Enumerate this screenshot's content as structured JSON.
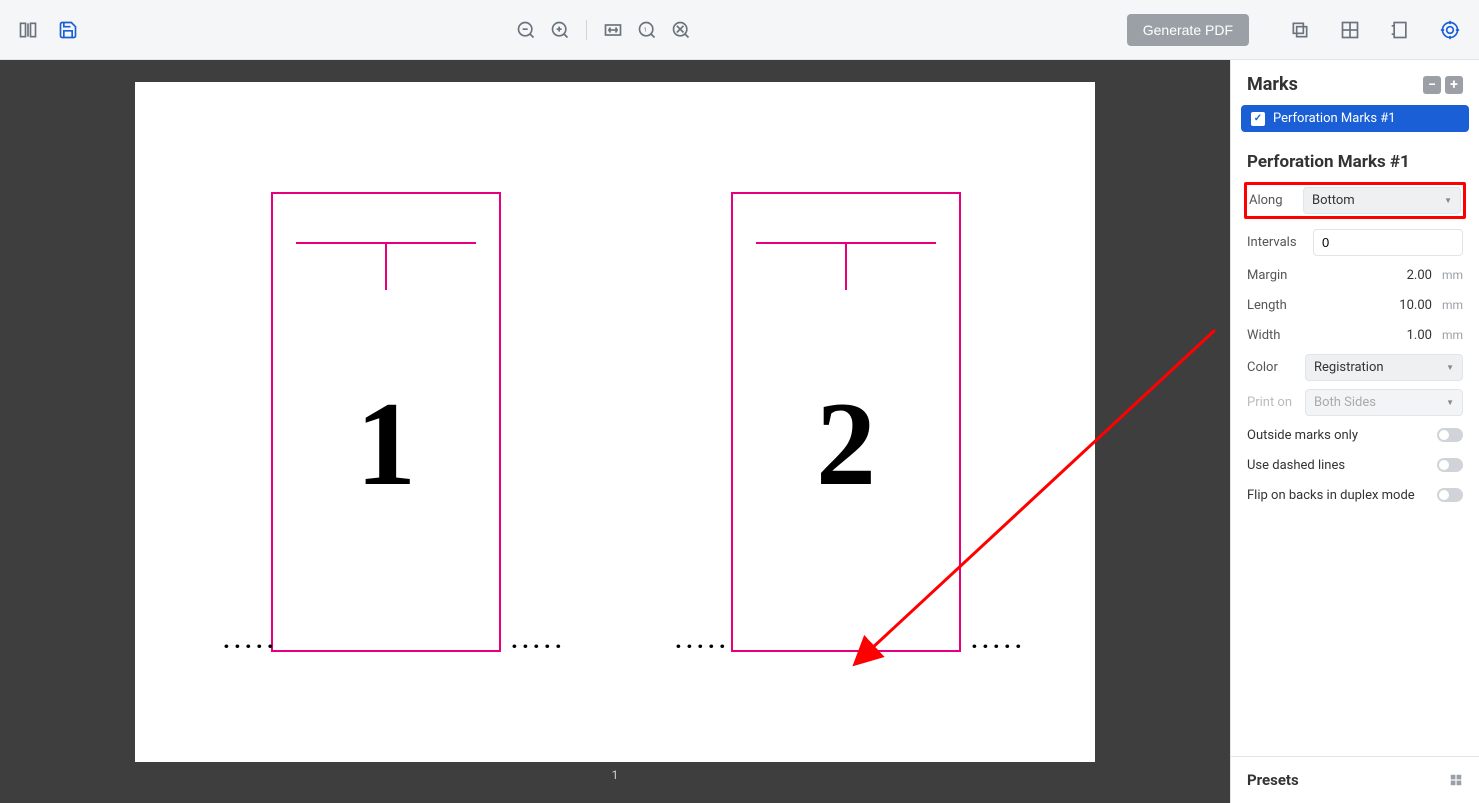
{
  "toolbar": {
    "generate_label": "Generate PDF"
  },
  "canvas": {
    "page_number": "1",
    "card1_num": "1",
    "card2_num": "2",
    "perf_glyph": "....."
  },
  "marks_panel": {
    "title": "Marks",
    "items": [
      {
        "label": "Perforation Marks #1"
      }
    ]
  },
  "props": {
    "title": "Perforation Marks #1",
    "along_label": "Along",
    "along_value": "Bottom",
    "intervals_label": "Intervals",
    "intervals_value": "0",
    "margin_label": "Margin",
    "margin_value": "2.00",
    "length_label": "Length",
    "length_value": "10.00",
    "width_label": "Width",
    "width_value": "1.00",
    "unit": "mm",
    "color_label": "Color",
    "color_value": "Registration",
    "printon_label": "Print on",
    "printon_value": "Both Sides",
    "outside_label": "Outside marks only",
    "dashed_label": "Use dashed lines",
    "flip_label": "Flip on backs in duplex mode"
  },
  "presets": {
    "title": "Presets"
  }
}
